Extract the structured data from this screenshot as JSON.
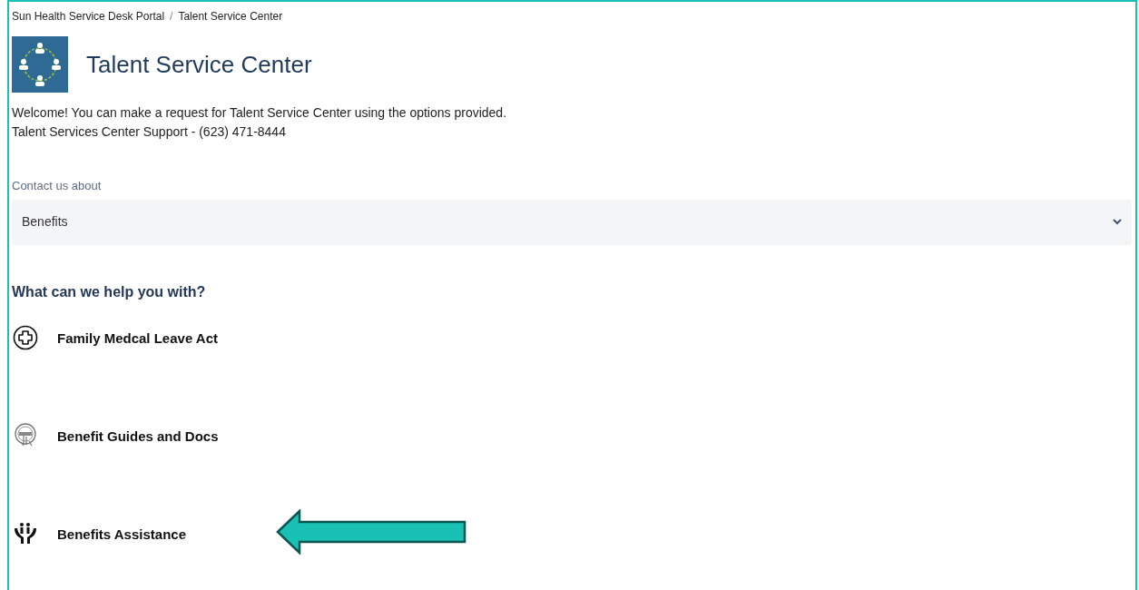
{
  "breadcrumbs": [
    "Sun Health Service Desk Portal",
    "/",
    "Talent Service Center"
  ],
  "title": "Talent Service Center",
  "welcome": [
    "Welcome! You can make a request for Talent Service Center using the options provided.",
    "Talent Services Center Support - (623) 471-8444"
  ],
  "contact": {
    "label": "Contact us about",
    "value": "Benefits"
  },
  "help_heading": "What can we help you with?",
  "request_types": [
    {
      "kind": "medical",
      "label": "Family Medcal Leave Act",
      "callout_arrow": false
    },
    {
      "kind": "guide",
      "label": "Benefit Guides and Docs",
      "callout_arrow": false
    },
    {
      "kind": "assistance",
      "label": "Benefits Assistance",
      "callout_arrow": true
    }
  ]
}
